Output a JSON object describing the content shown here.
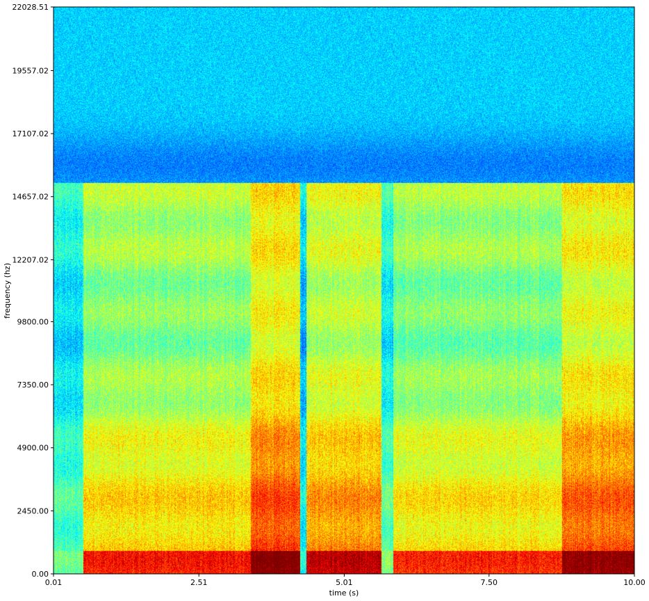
{
  "chart_data": {
    "type": "heatmap",
    "title": "",
    "xlabel": "time (s)",
    "ylabel": "frequency (hz)",
    "xlim": [
      0.01,
      10.0
    ],
    "ylim": [
      0.0,
      22028.51
    ],
    "x_ticks": [
      {
        "value": 0.01,
        "label": "0.01"
      },
      {
        "value": 2.51,
        "label": "2.51"
      },
      {
        "value": 5.01,
        "label": "5.01"
      },
      {
        "value": 7.5,
        "label": "7.50"
      },
      {
        "value": 10.0,
        "label": "10.00"
      }
    ],
    "y_ticks": [
      {
        "value": 0.0,
        "label": "0.00"
      },
      {
        "value": 2450.0,
        "label": "2450.00"
      },
      {
        "value": 4900.0,
        "label": "4900.00"
      },
      {
        "value": 7350.0,
        "label": "7350.00"
      },
      {
        "value": 9800.0,
        "label": "9800.00"
      },
      {
        "value": 12207.02,
        "label": "12207.02"
      },
      {
        "value": 14657.02,
        "label": "14657.02"
      },
      {
        "value": 17107.02,
        "label": "17107.02"
      },
      {
        "value": 19557.02,
        "label": "19557.02"
      },
      {
        "value": 22028.51,
        "label": "22028.51"
      }
    ],
    "colormap": "jet",
    "grid": false,
    "lowpass_cutoff_hz": 15200,
    "segments": [
      {
        "start": 0.01,
        "end": 0.52,
        "intensity": 0.42
      },
      {
        "start": 0.52,
        "end": 3.4,
        "intensity": 0.66
      },
      {
        "start": 3.4,
        "end": 4.25,
        "intensity": 0.82
      },
      {
        "start": 4.25,
        "end": 4.35,
        "intensity": 0.35
      },
      {
        "start": 4.35,
        "end": 5.65,
        "intensity": 0.74
      },
      {
        "start": 5.65,
        "end": 5.85,
        "intensity": 0.45
      },
      {
        "start": 5.85,
        "end": 8.75,
        "intensity": 0.64
      },
      {
        "start": 8.75,
        "end": 10.0,
        "intensity": 0.8
      }
    ]
  }
}
